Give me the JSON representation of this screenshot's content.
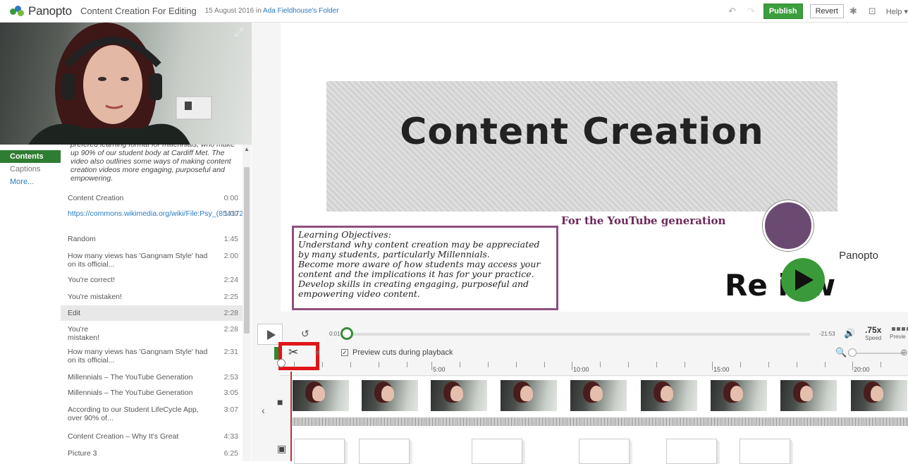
{
  "header": {
    "brand": "Panopto",
    "title": "Content Creation For Editing",
    "date": "15 August 2016",
    "in_text": "in",
    "folder": "Ada Fieldhouse's Folder",
    "publish_label": "Publish",
    "revert_label": "Revert",
    "help_label": "Help ▾"
  },
  "nav": {
    "items": [
      {
        "label": "Contents"
      },
      {
        "label": "Captions"
      },
      {
        "label": "More..."
      }
    ]
  },
  "contents": {
    "description": "prefered learning format for millennials, who make up 90% of our student body at Cardiff Met. The video also outlines some ways of making content creation videos more engaging, purposeful and empowering.",
    "rows": [
      {
        "label": "Content Creation",
        "time": "0:00"
      },
      {
        "label": "https://commons.wikimedia.org/wiki/File:Psy_(8541720534...",
        "time": "1:00"
      },
      {
        "label": "Random",
        "time": "1:45"
      },
      {
        "label": "How many views has 'Gangnam Style' had on its official...",
        "time": "2:00"
      },
      {
        "label": "You're correct!",
        "time": "2:24"
      },
      {
        "label": "You're mistaken!",
        "time": "2:25"
      },
      {
        "label": "Edit",
        "time": "2:28"
      },
      {
        "label": "You're mistaken!",
        "time": "2:28"
      },
      {
        "label": "How many views has 'Gangnam Style' had on its official...",
        "time": "2:31"
      },
      {
        "label": "Millennials – The YouTube Generation",
        "time": "2:53"
      },
      {
        "label": "Millennials – The YouTube Generation",
        "time": "3:05"
      },
      {
        "label": "According to our Student LifeCycle App, over 90% of...",
        "time": "3:07"
      },
      {
        "label": "Content Creation – Why It's Great",
        "time": "4:33"
      },
      {
        "label": "Picture 3",
        "time": "6:25"
      }
    ]
  },
  "slide": {
    "title": "Content Creation",
    "subtitle": "For the YouTube generation",
    "objectives": [
      "Learning Objectives:",
      "Understand why content creation may be appreciated by many students, particularly Millennials.",
      "Become more aware of how students may access your content and the implications it has for your practice.",
      "Develop skills in creating engaging, purposeful and empowering video content."
    ],
    "logo_brand": "Panopto",
    "logo_review": "Re    iew"
  },
  "player": {
    "time_current": "0:01",
    "time_remaining": "-21:53",
    "speed_value": ".75x",
    "speed_label": "Speed",
    "preview_label": "Previe"
  },
  "editor": {
    "preview_cuts_label": "Preview cuts during playback",
    "ruler_labels": [
      "5:00",
      "10:00",
      "15:00",
      "20:00"
    ]
  },
  "colors": {
    "accent_green": "#3c9e3c",
    "highlight_red": "#e0151a",
    "link_blue": "#2a7cc0",
    "objective_border": "#8e4f7f"
  }
}
